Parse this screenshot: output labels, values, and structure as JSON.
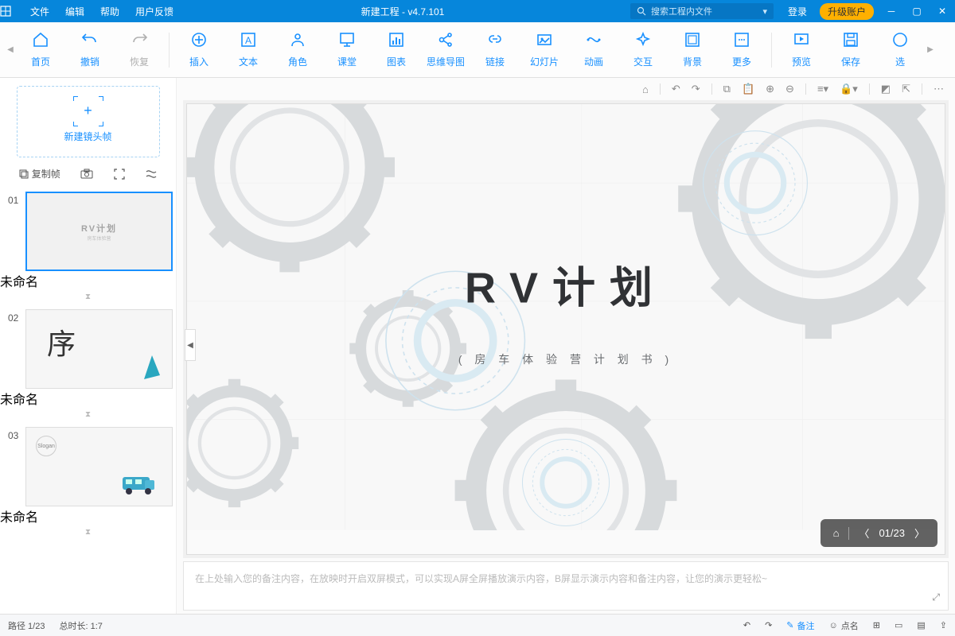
{
  "titlebar": {
    "menu": [
      "文件",
      "编辑",
      "帮助",
      "用户反馈"
    ],
    "title": "新建工程 - v4.7.101",
    "search_placeholder": "搜索工程内文件",
    "login": "登录",
    "upgrade": "升级账户"
  },
  "toolbar": {
    "items": [
      {
        "label": "首页",
        "icon": "home"
      },
      {
        "label": "撤销",
        "icon": "undo"
      },
      {
        "label": "恢复",
        "icon": "redo",
        "disabled": true
      }
    ],
    "items2": [
      {
        "label": "插入",
        "icon": "plus-circle"
      },
      {
        "label": "文本",
        "icon": "text"
      },
      {
        "label": "角色",
        "icon": "person"
      },
      {
        "label": "课堂",
        "icon": "class"
      },
      {
        "label": "图表",
        "icon": "chart"
      },
      {
        "label": "思维导图",
        "icon": "mindmap"
      },
      {
        "label": "链接",
        "icon": "link"
      },
      {
        "label": "幻灯片",
        "icon": "slide"
      },
      {
        "label": "动画",
        "icon": "anim"
      },
      {
        "label": "交互",
        "icon": "interact"
      },
      {
        "label": "背景",
        "icon": "bg"
      },
      {
        "label": "更多",
        "icon": "more"
      }
    ],
    "items3": [
      {
        "label": "预览",
        "icon": "preview"
      },
      {
        "label": "保存",
        "icon": "save"
      },
      {
        "label": "选",
        "icon": "select"
      }
    ]
  },
  "sidebar": {
    "newframe": "新建镜头帧",
    "copyframe": "复制帧",
    "slides": [
      {
        "num": "01",
        "caption": "未命名",
        "title": "RV计划",
        "sub": "房车体验营"
      },
      {
        "num": "02",
        "caption": "未命名",
        "seq": "序"
      },
      {
        "num": "03",
        "caption": "未命名",
        "van": true
      }
    ]
  },
  "canvas": {
    "title": "RV计划",
    "subtitle": "( 房 车 体 验 营 计 划 书 )",
    "page_indicator": "01/23"
  },
  "notes": {
    "placeholder": "在上处输入您的备注内容，在放映时开启双屏模式，可以实现A屏全屏播放演示内容，B屏显示演示内容和备注内容，让您的演示更轻松~"
  },
  "statusbar": {
    "path": "路径 1/23",
    "duration": "总时长: 1:7",
    "notes_btn": "备注",
    "count_btn": "点名"
  }
}
